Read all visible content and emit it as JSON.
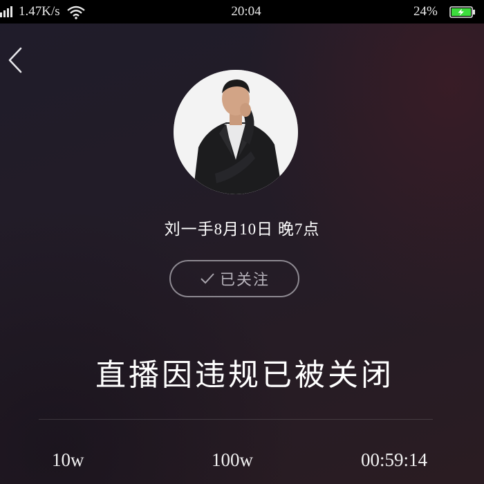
{
  "status_bar": {
    "net_speed": "1.47K/s",
    "time": "20:04",
    "battery": "24%",
    "battery_color": "#3ddc3d"
  },
  "icons": {
    "back": "chevron-left-icon",
    "signal": "signal-icon",
    "wifi": "wifi-icon",
    "battery": "battery-charging-icon",
    "check": "check-icon"
  },
  "room": {
    "title": "刘一手8月10日 晚7点",
    "follow_label": "已关注",
    "closed_message": "直播因违规已被关闭"
  },
  "stats": [
    "10w",
    "100w",
    "00:59:14"
  ],
  "colors": {
    "background": "#221c26",
    "button_border": "#8e8a92",
    "text": "#ffffff"
  }
}
